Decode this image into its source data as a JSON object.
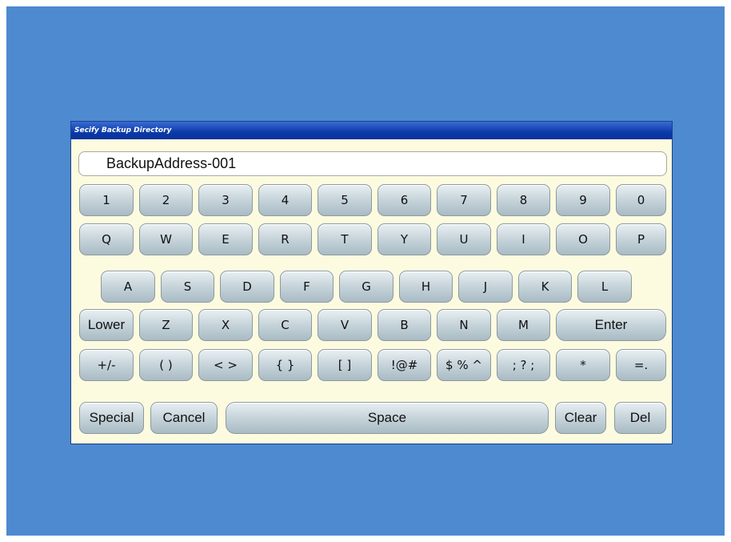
{
  "dialog": {
    "title": "Secify Backup Directory",
    "input_value": "BackupAddress-001"
  },
  "keyboard": {
    "row1": [
      "1",
      "2",
      "3",
      "4",
      "5",
      "6",
      "7",
      "8",
      "9",
      "0"
    ],
    "row2": [
      "Q",
      "W",
      "E",
      "R",
      "T",
      "Y",
      "U",
      "I",
      "O",
      "P"
    ],
    "row3": [
      "A",
      "S",
      "D",
      "F",
      "G",
      "H",
      "J",
      "K",
      "L"
    ],
    "row4": [
      "Lower",
      "Z",
      "X",
      "C",
      "V",
      "B",
      "N",
      "M",
      "Enter"
    ],
    "row5": [
      "+/-",
      "( )",
      "< >",
      "{ }",
      "[ ]",
      "!@#",
      "$ % ^",
      "; ? ;",
      "*",
      "=."
    ],
    "row6": [
      "Special",
      "Cancel",
      "Space",
      "Clear",
      "Del"
    ]
  },
  "colors": {
    "desktop": "#4e8ad0",
    "dialog_bg": "#fdfbdf",
    "titlebar": "#0a3aa9",
    "key_top": "#e9f0f3",
    "key_bottom": "#a9bbc4"
  }
}
